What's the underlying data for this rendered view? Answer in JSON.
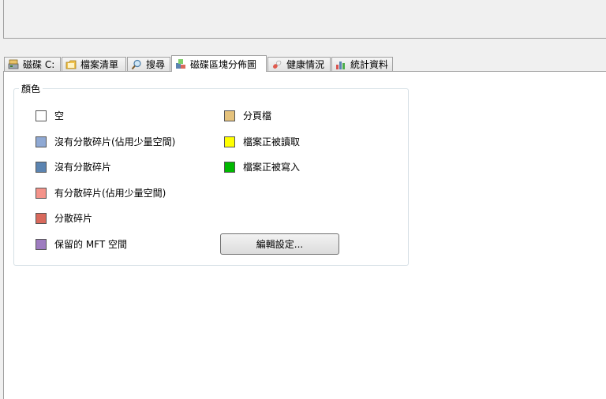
{
  "tabs": [
    {
      "label": "磁碟 C:",
      "icon": "drive-icon",
      "active": false
    },
    {
      "label": "檔案清單",
      "icon": "folder-icon",
      "active": false
    },
    {
      "label": "搜尋",
      "icon": "search-icon",
      "active": false
    },
    {
      "label": "磁碟區塊分佈圖",
      "icon": "blocks-icon",
      "active": true
    },
    {
      "label": "健康情況",
      "icon": "pill-icon",
      "active": false
    },
    {
      "label": "統計資料",
      "icon": "bar-chart-icon",
      "active": false
    }
  ],
  "colors_group": {
    "title": "顏色",
    "left_items": [
      {
        "label": "空",
        "color": "#ffffff"
      },
      {
        "label": "沒有分散碎片(佔用少量空間)",
        "color": "#8fa9d4"
      },
      {
        "label": "沒有分散碎片",
        "color": "#5b84b1"
      },
      {
        "label": "有分散碎片(佔用少量空間)",
        "color": "#f4938a"
      },
      {
        "label": "分散碎片",
        "color": "#d9695c"
      },
      {
        "label": "保留的 MFT 空間",
        "color": "#9e7cc0"
      }
    ],
    "right_items": [
      {
        "label": "分頁檔",
        "color": "#e5c27c"
      },
      {
        "label": "檔案正被讀取",
        "color": "#ffff00"
      },
      {
        "label": "檔案正被寫入",
        "color": "#00b800"
      }
    ],
    "edit_button_label": "編輯設定..."
  }
}
